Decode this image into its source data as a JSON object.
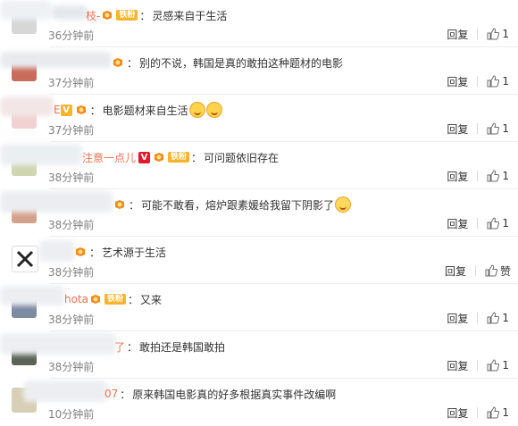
{
  "comments": [
    {
      "name": "枝-",
      "badge": "铁粉",
      "text": "灵感来自于生活",
      "time": "36分钟前",
      "reply": "回复",
      "like": "1"
    },
    {
      "name": "",
      "badge": "",
      "text": "别的不说，韩国是真的敢拍这种题材的电影",
      "time": "37分钟前",
      "reply": "回复",
      "like": "1"
    },
    {
      "name": "E",
      "badge": "",
      "text": "电影题材来自生活",
      "time": "37分钟前",
      "reply": "回复",
      "like": "1"
    },
    {
      "name": "注意一点儿",
      "badge": "铁粉",
      "text": "可问题依旧存在",
      "time": "38分钟前",
      "reply": "回复",
      "like": "1"
    },
    {
      "name": "",
      "badge": "",
      "text": "可能不敢看，熔炉跟素媛给我留下阴影了",
      "time": "38分钟前",
      "reply": "回复",
      "like": "1"
    },
    {
      "name": "",
      "badge": "",
      "text": "艺术源于生活",
      "time": "38分钟前",
      "reply": "回复",
      "like": "赞"
    },
    {
      "name": "hota",
      "badge": "铁粉",
      "text": "又来",
      "time": "38分钟前",
      "reply": "回复",
      "like": "1"
    },
    {
      "name": "了",
      "badge": "",
      "text": "敢拍还是韩国敢拍",
      "time": "38分钟前",
      "reply": "回复",
      "like": "1"
    },
    {
      "name": "07",
      "badge": "",
      "text": "原来韩国电影真的好多根据真实事件改编啊",
      "time": "10分钟前",
      "reply": "回复",
      "like": "1"
    }
  ],
  "colors": {
    "username": "#eb7350",
    "time": "#808080",
    "badge": "#f7b42c"
  }
}
